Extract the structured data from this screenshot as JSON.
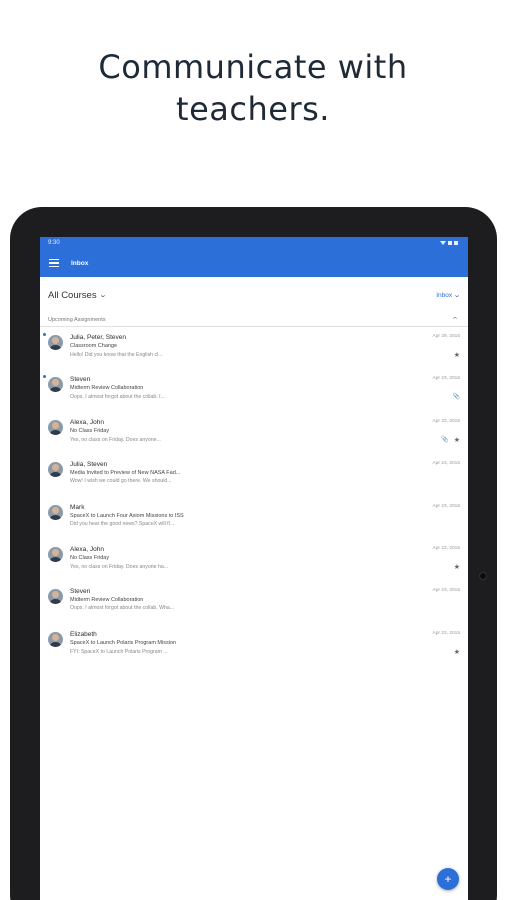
{
  "headline": {
    "line1": "Communicate with",
    "line2": "teachers."
  },
  "status_bar": {
    "time": "9:30"
  },
  "app_bar": {
    "title": "Inbox"
  },
  "filters": {
    "course": "All Courses",
    "box": "Inbox"
  },
  "section": {
    "label": "Upcoming Assignments"
  },
  "messages": [
    {
      "authors": "Julia, Peter, Steven",
      "date": "Apr 29, 2015",
      "subject": "Classroom Change",
      "preview": "Hello! Did you know that the English cl...",
      "unread": true,
      "starred": true,
      "attachment": false
    },
    {
      "authors": "Steven",
      "date": "Apr 23, 2015",
      "subject": "Midterm Review Collaboration",
      "preview": "Oops, I almost forgot about the collab. I...",
      "unread": true,
      "starred": false,
      "attachment": true
    },
    {
      "authors": "Alexa, John",
      "date": "Apr 23, 2015",
      "subject": "No Class Friday",
      "preview": "Yes, no class on Friday. Does anyone...",
      "unread": false,
      "starred": true,
      "attachment": true
    },
    {
      "authors": "Julia, Steven",
      "date": "Apr 23, 2015",
      "subject": "Media Invited to Preview of New NASA Fad...",
      "preview": "Wow! I wish we could go there. We should...",
      "unread": false,
      "starred": false,
      "attachment": false
    },
    {
      "authors": "Mark",
      "date": "Apr 23, 2015",
      "subject": "SpaceX to Launch Four Axiom Missions to ISS",
      "preview": "Did you hear the good news? SpaceX will fl...",
      "unread": false,
      "starred": false,
      "attachment": false
    },
    {
      "authors": "Alexa, John",
      "date": "Apr 23, 2015",
      "subject": "No Class Friday",
      "preview": "Yes, no class on Friday. Does anyone ha...",
      "unread": false,
      "starred": true,
      "attachment": false
    },
    {
      "authors": "Steven",
      "date": "Apr 23, 2015",
      "subject": "Midterm Review Collaboration",
      "preview": "Oops, I almost forgot about the collab. Wha...",
      "unread": false,
      "starred": false,
      "attachment": false
    },
    {
      "authors": "Elizabeth",
      "date": "Apr 23, 2015",
      "subject": "SpaceX to Launch Polaris Program Mission",
      "preview": "FYI: SpaceX to Launch Polaris Program ...",
      "unread": false,
      "starred": true,
      "attachment": false
    }
  ],
  "fab": {
    "label": "+"
  },
  "icons": {
    "menu": "hamburger-menu-icon",
    "star": "star-icon",
    "attachment": "paperclip-icon",
    "compose": "compose-plus-icon"
  },
  "colors": {
    "brand": "#2d6fd9",
    "headline": "#1f2a37"
  }
}
